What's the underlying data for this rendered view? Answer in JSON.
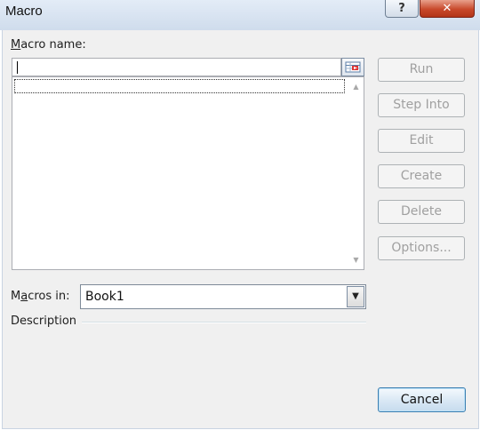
{
  "window": {
    "title": "Macro",
    "help_glyph": "?",
    "close_glyph": "✕"
  },
  "macro_name": {
    "label_accel": "M",
    "label_rest": "acro name:",
    "value": "",
    "ref_icon": "collapse-dialog-icon"
  },
  "macro_list": {
    "items": [],
    "scroll_up": "▲",
    "scroll_down": "▼"
  },
  "buttons": {
    "run": "Run",
    "step_into": "Step Into",
    "edit": "Edit",
    "create": "Create",
    "delete": "Delete",
    "options": "Options...",
    "cancel": "Cancel"
  },
  "macros_in": {
    "label_pre": "M",
    "label_accel": "a",
    "label_post": "cros in:",
    "selected": "Book1",
    "dropdown_glyph": "▼"
  },
  "description": {
    "label": "Description"
  },
  "colors": {
    "disabled_text": "#a0a0a0",
    "default_button_border": "#3c7fb1"
  }
}
